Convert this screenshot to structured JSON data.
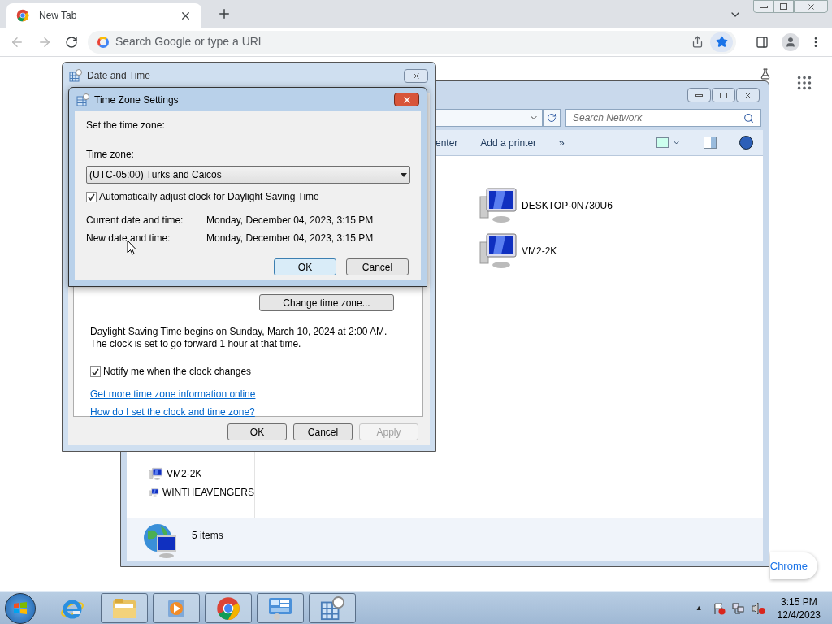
{
  "browser": {
    "tab": {
      "title": "New Tab"
    },
    "address": {
      "placeholder": "Search Google or type a URL"
    },
    "customize_button": "Chrome"
  },
  "explorer": {
    "search": {
      "placeholder": "Search Network"
    },
    "toolbar": [
      "enter",
      "Add a printer",
      "»"
    ],
    "nav_items": [
      "VM2-2K",
      "WINTHEAVENGERS"
    ],
    "computers": [
      "DESKTOP-0N730U6",
      "VM2-2K"
    ],
    "status": "5 items"
  },
  "date_time_dialog": {
    "title": "Date and Time",
    "change_button": "Change time zone...",
    "dst_text": "Daylight Saving Time begins on Sunday, March 10, 2024 at 2:00 AM. The clock is set to go forward 1 hour at that time.",
    "notify": {
      "label": "Notify me when the clock changes",
      "checked": true
    },
    "links": [
      "Get more time zone information online",
      "How do I set the clock and time zone?"
    ],
    "buttons": [
      {
        "label": "OK",
        "disabled": false
      },
      {
        "label": "Cancel",
        "disabled": false
      },
      {
        "label": "Apply",
        "disabled": true
      }
    ]
  },
  "time_zone_dialog": {
    "title": "Time Zone Settings",
    "prompt": "Set the time zone:",
    "zone_label": "Time zone:",
    "zone_value": "(UTC-05:00) Turks and Caicos",
    "auto_dst": {
      "label": "Automatically adjust clock for Daylight Saving Time",
      "checked": true
    },
    "rows": [
      {
        "label": "Current date and time:",
        "value": "Monday, December 04, 2023, 3:15 PM"
      },
      {
        "label": "New date and time:",
        "value": "Monday, December 04, 2023, 3:15 PM"
      }
    ],
    "buttons": [
      {
        "label": "OK",
        "default": true
      },
      {
        "label": "Cancel",
        "default": false
      }
    ]
  },
  "taskbar": {
    "apps": [
      {
        "kind": "ie",
        "running": false
      },
      {
        "kind": "folder",
        "running": true
      },
      {
        "kind": "media",
        "running": true
      },
      {
        "kind": "chrome",
        "running": true
      },
      {
        "kind": "control",
        "running": true
      },
      {
        "kind": "calendar",
        "running": true
      }
    ],
    "tray": {
      "arrow": "▲",
      "time": "3:15 PM",
      "date": "12/4/2023"
    }
  }
}
